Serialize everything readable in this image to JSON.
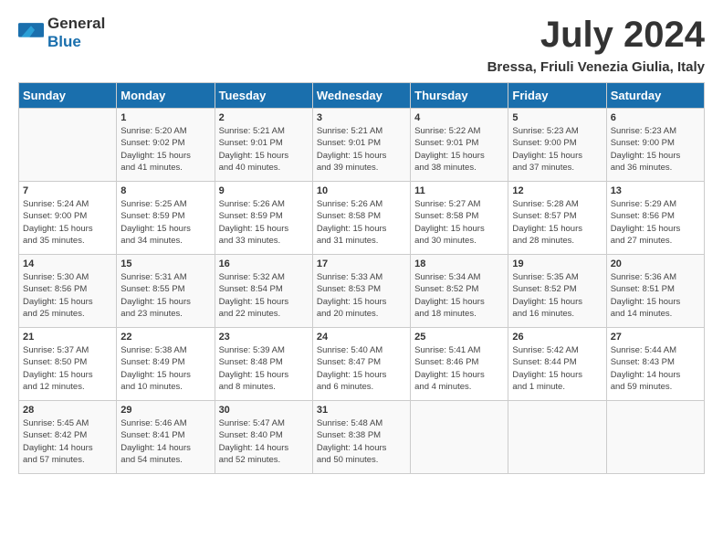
{
  "logo": {
    "general": "General",
    "blue": "Blue"
  },
  "title": "July 2024",
  "location": "Bressa, Friuli Venezia Giulia, Italy",
  "headers": [
    "Sunday",
    "Monday",
    "Tuesday",
    "Wednesday",
    "Thursday",
    "Friday",
    "Saturday"
  ],
  "weeks": [
    [
      {
        "day": "",
        "info": ""
      },
      {
        "day": "1",
        "info": "Sunrise: 5:20 AM\nSunset: 9:02 PM\nDaylight: 15 hours\nand 41 minutes."
      },
      {
        "day": "2",
        "info": "Sunrise: 5:21 AM\nSunset: 9:01 PM\nDaylight: 15 hours\nand 40 minutes."
      },
      {
        "day": "3",
        "info": "Sunrise: 5:21 AM\nSunset: 9:01 PM\nDaylight: 15 hours\nand 39 minutes."
      },
      {
        "day": "4",
        "info": "Sunrise: 5:22 AM\nSunset: 9:01 PM\nDaylight: 15 hours\nand 38 minutes."
      },
      {
        "day": "5",
        "info": "Sunrise: 5:23 AM\nSunset: 9:00 PM\nDaylight: 15 hours\nand 37 minutes."
      },
      {
        "day": "6",
        "info": "Sunrise: 5:23 AM\nSunset: 9:00 PM\nDaylight: 15 hours\nand 36 minutes."
      }
    ],
    [
      {
        "day": "7",
        "info": "Sunrise: 5:24 AM\nSunset: 9:00 PM\nDaylight: 15 hours\nand 35 minutes."
      },
      {
        "day": "8",
        "info": "Sunrise: 5:25 AM\nSunset: 8:59 PM\nDaylight: 15 hours\nand 34 minutes."
      },
      {
        "day": "9",
        "info": "Sunrise: 5:26 AM\nSunset: 8:59 PM\nDaylight: 15 hours\nand 33 minutes."
      },
      {
        "day": "10",
        "info": "Sunrise: 5:26 AM\nSunset: 8:58 PM\nDaylight: 15 hours\nand 31 minutes."
      },
      {
        "day": "11",
        "info": "Sunrise: 5:27 AM\nSunset: 8:58 PM\nDaylight: 15 hours\nand 30 minutes."
      },
      {
        "day": "12",
        "info": "Sunrise: 5:28 AM\nSunset: 8:57 PM\nDaylight: 15 hours\nand 28 minutes."
      },
      {
        "day": "13",
        "info": "Sunrise: 5:29 AM\nSunset: 8:56 PM\nDaylight: 15 hours\nand 27 minutes."
      }
    ],
    [
      {
        "day": "14",
        "info": "Sunrise: 5:30 AM\nSunset: 8:56 PM\nDaylight: 15 hours\nand 25 minutes."
      },
      {
        "day": "15",
        "info": "Sunrise: 5:31 AM\nSunset: 8:55 PM\nDaylight: 15 hours\nand 23 minutes."
      },
      {
        "day": "16",
        "info": "Sunrise: 5:32 AM\nSunset: 8:54 PM\nDaylight: 15 hours\nand 22 minutes."
      },
      {
        "day": "17",
        "info": "Sunrise: 5:33 AM\nSunset: 8:53 PM\nDaylight: 15 hours\nand 20 minutes."
      },
      {
        "day": "18",
        "info": "Sunrise: 5:34 AM\nSunset: 8:52 PM\nDaylight: 15 hours\nand 18 minutes."
      },
      {
        "day": "19",
        "info": "Sunrise: 5:35 AM\nSunset: 8:52 PM\nDaylight: 15 hours\nand 16 minutes."
      },
      {
        "day": "20",
        "info": "Sunrise: 5:36 AM\nSunset: 8:51 PM\nDaylight: 15 hours\nand 14 minutes."
      }
    ],
    [
      {
        "day": "21",
        "info": "Sunrise: 5:37 AM\nSunset: 8:50 PM\nDaylight: 15 hours\nand 12 minutes."
      },
      {
        "day": "22",
        "info": "Sunrise: 5:38 AM\nSunset: 8:49 PM\nDaylight: 15 hours\nand 10 minutes."
      },
      {
        "day": "23",
        "info": "Sunrise: 5:39 AM\nSunset: 8:48 PM\nDaylight: 15 hours\nand 8 minutes."
      },
      {
        "day": "24",
        "info": "Sunrise: 5:40 AM\nSunset: 8:47 PM\nDaylight: 15 hours\nand 6 minutes."
      },
      {
        "day": "25",
        "info": "Sunrise: 5:41 AM\nSunset: 8:46 PM\nDaylight: 15 hours\nand 4 minutes."
      },
      {
        "day": "26",
        "info": "Sunrise: 5:42 AM\nSunset: 8:44 PM\nDaylight: 15 hours\nand 1 minute."
      },
      {
        "day": "27",
        "info": "Sunrise: 5:44 AM\nSunset: 8:43 PM\nDaylight: 14 hours\nand 59 minutes."
      }
    ],
    [
      {
        "day": "28",
        "info": "Sunrise: 5:45 AM\nSunset: 8:42 PM\nDaylight: 14 hours\nand 57 minutes."
      },
      {
        "day": "29",
        "info": "Sunrise: 5:46 AM\nSunset: 8:41 PM\nDaylight: 14 hours\nand 54 minutes."
      },
      {
        "day": "30",
        "info": "Sunrise: 5:47 AM\nSunset: 8:40 PM\nDaylight: 14 hours\nand 52 minutes."
      },
      {
        "day": "31",
        "info": "Sunrise: 5:48 AM\nSunset: 8:38 PM\nDaylight: 14 hours\nand 50 minutes."
      },
      {
        "day": "",
        "info": ""
      },
      {
        "day": "",
        "info": ""
      },
      {
        "day": "",
        "info": ""
      }
    ]
  ]
}
